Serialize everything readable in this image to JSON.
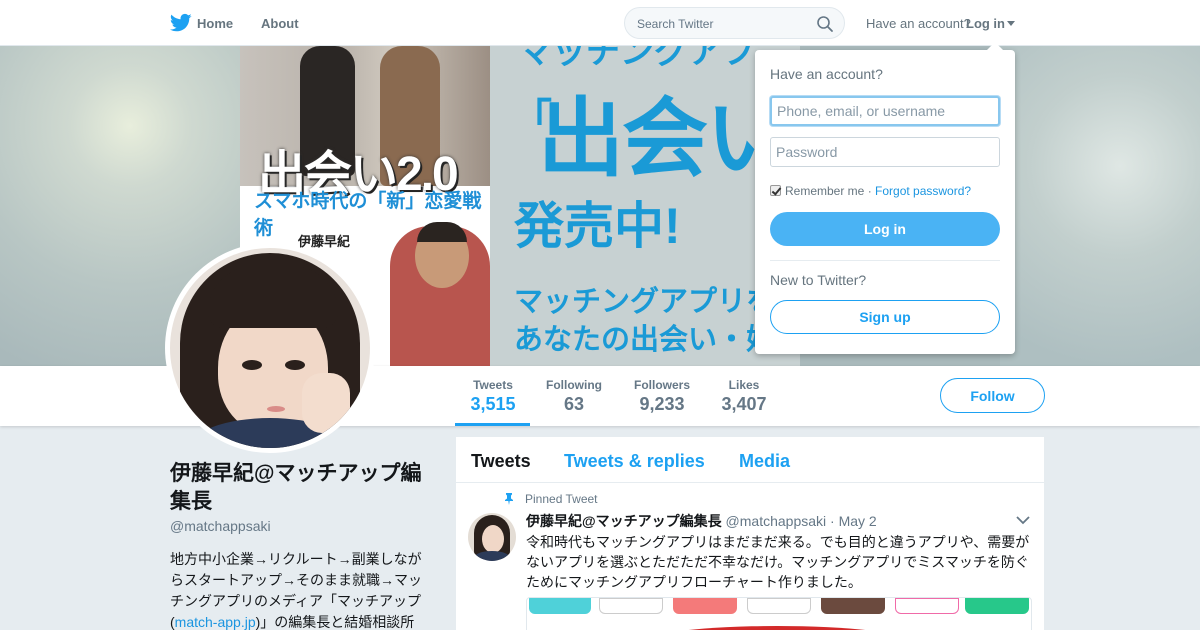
{
  "nav": {
    "logo_icon": "twitter-bird-icon",
    "home_label": "Home",
    "about_label": "About",
    "search_placeholder": "Search Twitter",
    "have_account": "Have an account?",
    "login_label": "Log in"
  },
  "banner": {
    "book_title": "出会い2.0",
    "book_subtitle": "スマホ時代の「新」恋愛戦術",
    "book_author": "伊藤早紀",
    "ad_top": "マッチングアプ",
    "ad_bracket": "「",
    "ad_big": "出会い",
    "ad_sale": "発売中!",
    "ad_line1": "マッチングアプリを",
    "ad_line2": "あなたの出会い・婚"
  },
  "stats": [
    {
      "label": "Tweets",
      "value": "3,515"
    },
    {
      "label": "Following",
      "value": "63"
    },
    {
      "label": "Followers",
      "value": "9,233"
    },
    {
      "label": "Likes",
      "value": "3,407"
    }
  ],
  "follow_label": "Follow",
  "profile": {
    "name": "伊藤早紀@マッチアップ編集長",
    "handle": "@matchappsaki",
    "bio_before": "地方中小企業→リクルート→副業しながらスタートアップ→そのまま就職→マッチングアプリのメディア「マッチアップ(",
    "bio_link": "match-app.jp",
    "bio_after": ")」の編集長と結婚相談所"
  },
  "timeline": {
    "tabs": [
      "Tweets",
      "Tweets & replies",
      "Media"
    ],
    "pinned_label": "Pinned Tweet",
    "tweet": {
      "name": "伊藤早紀@マッチアップ編集長",
      "handle": "@matchappsaki",
      "date": "May 2",
      "text": "令和時代もマッチングアプリはまだまだ来る。でも目的と違うアプリや、需要がないアプリを選ぶとただただ不幸なだけ。マッチングアプリでミスマッチを防ぐためにマッチングアプリフローチャート作りました。"
    }
  },
  "login_dropdown": {
    "title": "Have an account?",
    "username_placeholder": "Phone, email, or username",
    "password_placeholder": "Password",
    "remember": "Remember me",
    "forgot": "Forgot password?",
    "login_button": "Log in",
    "new_to": "New to Twitter?",
    "signup_button": "Sign up"
  },
  "colors": {
    "accent": "#1da1f2",
    "login_button": "#4ab3f4",
    "banner_text": "#1a9ad6"
  }
}
